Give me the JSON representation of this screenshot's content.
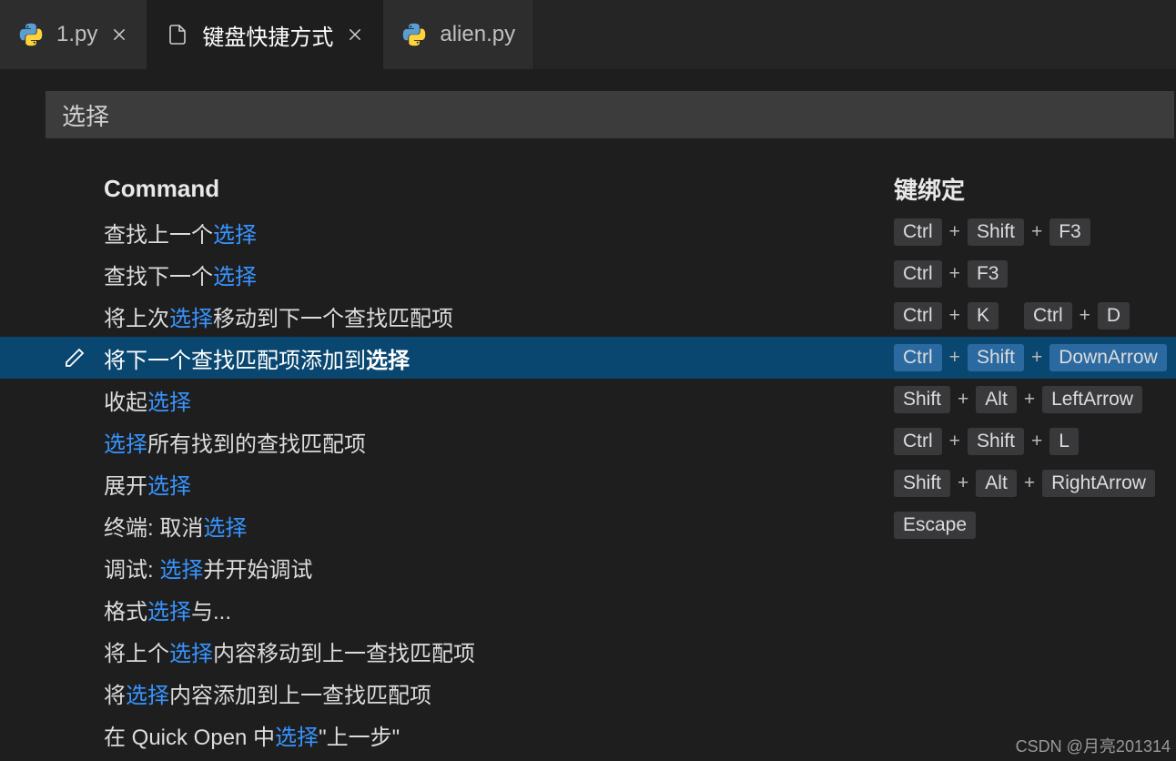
{
  "tabs": [
    {
      "icon": "python",
      "label": "1.py",
      "closable": true,
      "active": false
    },
    {
      "icon": "file",
      "label": "键盘快捷方式",
      "closable": true,
      "active": true
    },
    {
      "icon": "python",
      "label": "alien.py",
      "closable": false,
      "active": false
    }
  ],
  "search": {
    "value": "选择"
  },
  "headers": {
    "command": "Command",
    "keybinding": "键绑定"
  },
  "rows": [
    {
      "parts": [
        "查找上一个",
        "选择"
      ],
      "keys": [
        [
          "Ctrl",
          "Shift",
          "F3"
        ]
      ],
      "selected": false
    },
    {
      "parts": [
        "查找下一个",
        "选择"
      ],
      "keys": [
        [
          "Ctrl",
          "F3"
        ]
      ],
      "selected": false
    },
    {
      "parts": [
        "将上次",
        "选择",
        "移动到下一个查找匹配项"
      ],
      "keys": [
        [
          "Ctrl",
          "K"
        ],
        [
          "Ctrl",
          "D"
        ]
      ],
      "selected": false
    },
    {
      "parts": [
        "将下一个查找匹配项添加到",
        "选择"
      ],
      "keys": [
        [
          "Ctrl",
          "Shift",
          "DownArrow"
        ]
      ],
      "selected": true
    },
    {
      "parts": [
        "收起",
        "选择"
      ],
      "keys": [
        [
          "Shift",
          "Alt",
          "LeftArrow"
        ]
      ],
      "selected": false
    },
    {
      "parts": [
        "",
        "选择",
        "所有找到的查找匹配项"
      ],
      "keys": [
        [
          "Ctrl",
          "Shift",
          "L"
        ]
      ],
      "selected": false
    },
    {
      "parts": [
        "展开",
        "选择"
      ],
      "keys": [
        [
          "Shift",
          "Alt",
          "RightArrow"
        ]
      ],
      "selected": false
    },
    {
      "parts": [
        "终端: 取消",
        "选择"
      ],
      "keys": [
        [
          "Escape"
        ]
      ],
      "selected": false
    },
    {
      "parts": [
        "调试: ",
        "选择",
        "并开始调试"
      ],
      "keys": [],
      "selected": false
    },
    {
      "parts": [
        "格式",
        "选择",
        "与..."
      ],
      "keys": [],
      "selected": false
    },
    {
      "parts": [
        "将上个",
        "选择",
        "内容移动到上一查找匹配项"
      ],
      "keys": [],
      "selected": false
    },
    {
      "parts": [
        "将",
        "选择",
        "内容添加到上一查找匹配项"
      ],
      "keys": [],
      "selected": false
    },
    {
      "parts": [
        "在 Quick Open 中",
        "选择",
        "\"上一步\""
      ],
      "keys": [],
      "selected": false
    }
  ],
  "plus": "+",
  "watermark": "CSDN @月亮201314"
}
